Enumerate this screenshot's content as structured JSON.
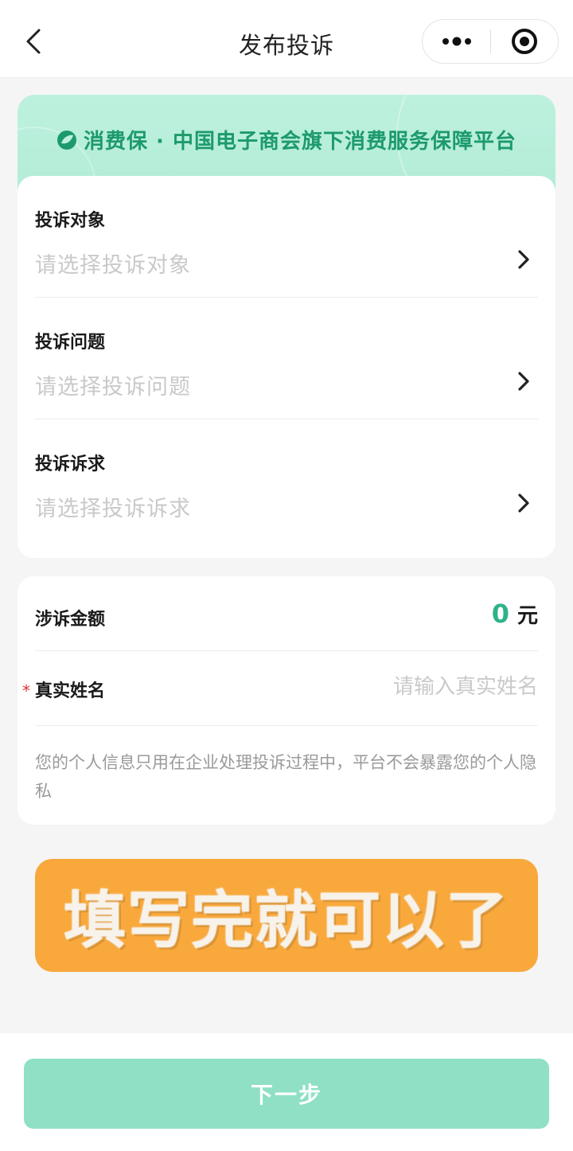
{
  "header": {
    "title": "发布投诉",
    "back_icon": "chevron-left-icon",
    "more_icon": "more-dots-icon",
    "close_icon": "target-close-icon"
  },
  "banner": {
    "text": "消费保 · 中国电子商会旗下消费服务保障平台",
    "logo_icon": "leaf-logo-icon"
  },
  "complaint_form": {
    "rows": [
      {
        "label": "投诉对象",
        "placeholder": "请选择投诉对象"
      },
      {
        "label": "投诉问题",
        "placeholder": "请选择投诉问题"
      },
      {
        "label": "投诉诉求",
        "placeholder": "请选择投诉诉求"
      }
    ]
  },
  "details": {
    "amount_label": "涉诉金额",
    "amount_value": "0",
    "amount_unit": "元",
    "name_required_mark": "*",
    "name_label": "真实姓名",
    "name_placeholder": "请输入真实姓名",
    "privacy_note": "您的个人信息只用在企业处理投诉过程中，平台不会暴露您的个人隐私"
  },
  "promo": {
    "text": "填写完就可以了"
  },
  "footer": {
    "next_label": "下一步"
  },
  "colors": {
    "accent_green": "#2fb28a",
    "banner_text": "#1d9a6c",
    "button_bg": "#8fe0c5",
    "promo_bg": "#f9a83c",
    "required_red": "#e0303a"
  }
}
